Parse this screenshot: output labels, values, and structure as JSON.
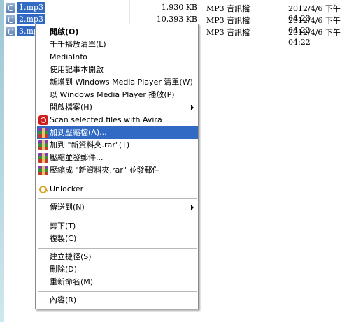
{
  "files": [
    {
      "name": "1.mp3",
      "size": "1,930 KB",
      "type": "MP3 音訊檔",
      "date": "2012/4/6 下午 04:23"
    },
    {
      "name": "2.mp3",
      "size": "10,393 KB",
      "type": "MP3 音訊檔",
      "date": "2012/4/6 下午 04:22"
    },
    {
      "name": "3.mp3",
      "size": "",
      "type": "MP3 音訊檔",
      "date": "2012/4/6 下午 04:22"
    }
  ],
  "menu": {
    "open": "開啟(O)",
    "add_playlist": "千千播放清單(L)",
    "mediainfo": "MediaInfo",
    "notepad": "使用記事本開啟",
    "wmp_add": "新增到 Windows Media Player 清單(W)",
    "wmp_play": "以 Windows Media Player 播放(P)",
    "open_with": "開啟檔案(H)",
    "avira": "Scan selected files with Avira",
    "add_archive": "加到壓縮檔(A)...",
    "add_rar": "加到 \"新資料夾.rar\"(T)",
    "compress_email": "壓縮並發郵件...",
    "compress_rar_email": "壓縮成 \"新資料夾.rar\" 並發郵件",
    "unlocker": "Unlocker",
    "send_to": "傳送到(N)",
    "cut": "剪下(T)",
    "copy": "複製(C)",
    "create_shortcut": "建立捷徑(S)",
    "delete": "刪除(D)",
    "rename": "重新命名(M)",
    "properties": "內容(R)"
  },
  "colors": {
    "highlight": "#316ac5"
  }
}
